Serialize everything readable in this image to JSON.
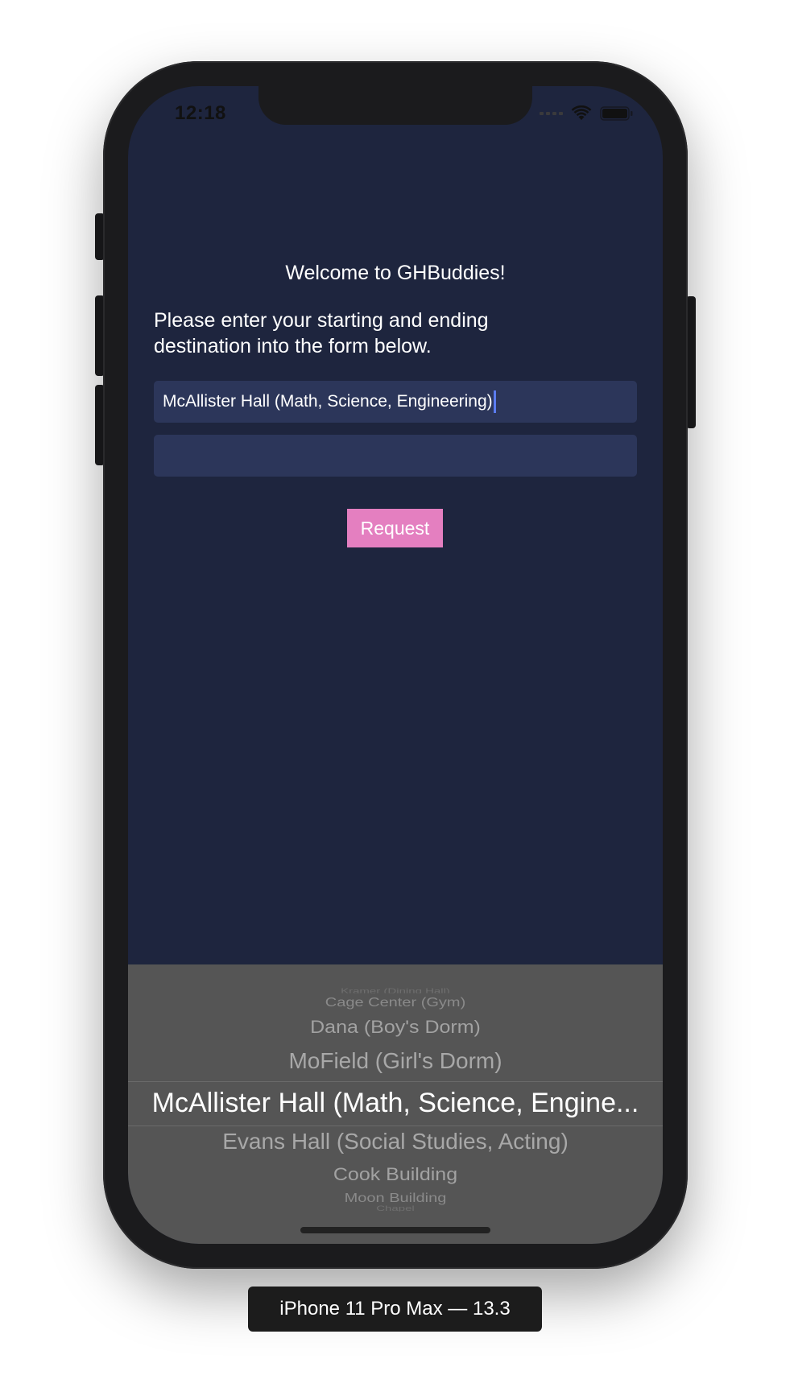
{
  "status_bar": {
    "time": "12:18",
    "icons": [
      "signal-icon",
      "wifi-icon",
      "battery-icon"
    ]
  },
  "main": {
    "welcome": "Welcome to GHBuddies!",
    "instructions": "Please enter your starting and ending destination into the form below.",
    "start_field_value": "McAllister Hall (Math, Science, Engineering)",
    "end_field_value": "",
    "request_label": "Request"
  },
  "picker": {
    "items": [
      "Kramer (Dining Hall)",
      "Cage Center (Gym)",
      "Dana (Boy's Dorm)",
      "MoField (Girl's Dorm)",
      "McAllister Hall (Math, Science, Engine...",
      "Evans Hall (Social Studies, Acting)",
      "Cook Building",
      "Moon Building",
      "Chapel"
    ],
    "selected": "McAllister Hall (Math, Science, Engine..."
  },
  "device_label": "iPhone 11 Pro Max — 13.3",
  "colors": {
    "background": "#1e253e",
    "field": "#2c365a",
    "button": "#e47fc0",
    "picker": "#555555",
    "caret": "#5b7cf0"
  }
}
